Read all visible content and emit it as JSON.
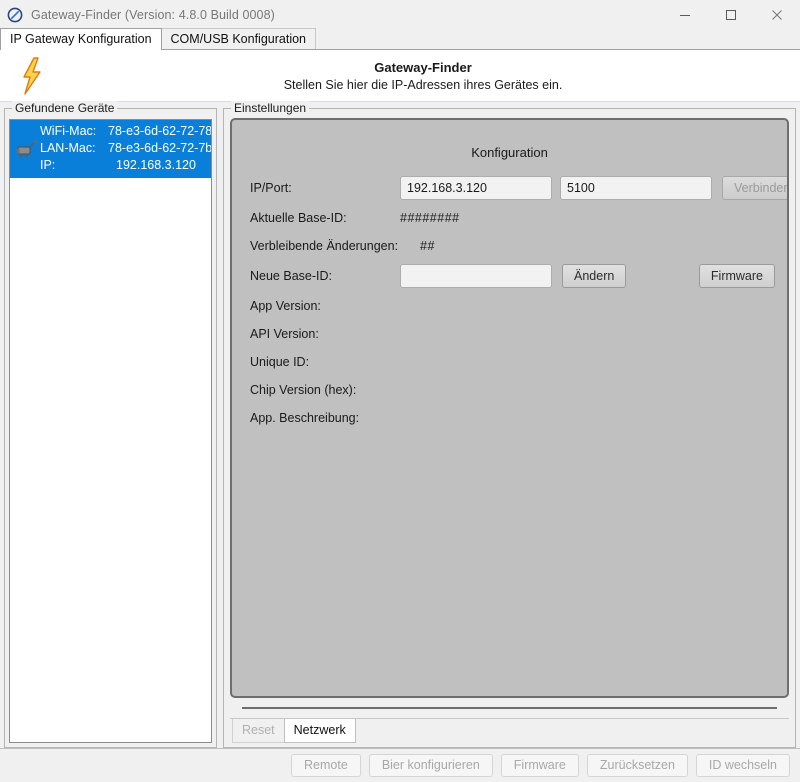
{
  "window": {
    "title": "Gateway-Finder (Version: 4.8.0 Build 0008)",
    "icon": "circle-slash-icon",
    "controls": {
      "minimize": "minimize-icon",
      "maximize": "maximize-icon",
      "close": "close-icon"
    }
  },
  "tabs": [
    {
      "label": "IP Gateway Konfiguration",
      "active": true
    },
    {
      "label": "COM/USB Konfiguration",
      "active": false
    }
  ],
  "banner": {
    "icon": "lightning-bolt-icon",
    "title": "Gateway-Finder",
    "subtitle": "Stellen Sie hier die IP-Adressen ihres Gerätes ein."
  },
  "devices_panel": {
    "legend": "Gefundene Geräte",
    "items": [
      {
        "icon": "router-device-icon",
        "selected": true,
        "rows": [
          {
            "key": "WiFi-Mac:",
            "value": "78-e3-6d-62-72-78"
          },
          {
            "key": "LAN-Mac:",
            "value": "78-e3-6d-62-72-7b"
          },
          {
            "key": "IP:",
            "value": "192.168.3.120"
          }
        ]
      }
    ]
  },
  "settings_panel": {
    "legend": "Einstellungen",
    "config_title": "Konfiguration",
    "fields": {
      "ip_port_label": "IP/Port:",
      "ip_value": "192.168.3.120",
      "port_value": "5100",
      "connect_button": "Verbinden",
      "current_base_id_label": "Aktuelle Base-ID:",
      "current_base_id_value": "########",
      "remaining_changes_label": "Verbleibende Änderungen:",
      "remaining_changes_value": "##",
      "new_base_id_label": "Neue Base-ID:",
      "new_base_id_value": "",
      "change_button": "Ändern",
      "firmware_button": "Firmware",
      "app_version_label": "App Version:",
      "app_version_value": "",
      "api_version_label": "API Version:",
      "api_version_value": "",
      "unique_id_label": "Unique ID:",
      "unique_id_value": "",
      "chip_version_label": "Chip Version (hex):",
      "chip_version_value": "",
      "app_description_label": "App. Beschreibung:",
      "app_description_value": ""
    },
    "bottom_tabs": [
      {
        "label": "Reset",
        "active": false
      },
      {
        "label": "Netzwerk",
        "active": true
      }
    ]
  },
  "action_bar": {
    "buttons": [
      {
        "label": "Remote"
      },
      {
        "label": "Bier konfigurieren"
      },
      {
        "label": "Firmware"
      },
      {
        "label": "Zurücksetzen"
      },
      {
        "label": "ID wechseln"
      }
    ]
  },
  "colors": {
    "selection_blue": "#0a7fd9",
    "window_bg": "#f0f0f0",
    "config_panel_bg": "#c0c0c0",
    "title_text": "#777777",
    "disabled_text": "#a8a8a8",
    "accent_bolt": "#f5a623"
  }
}
